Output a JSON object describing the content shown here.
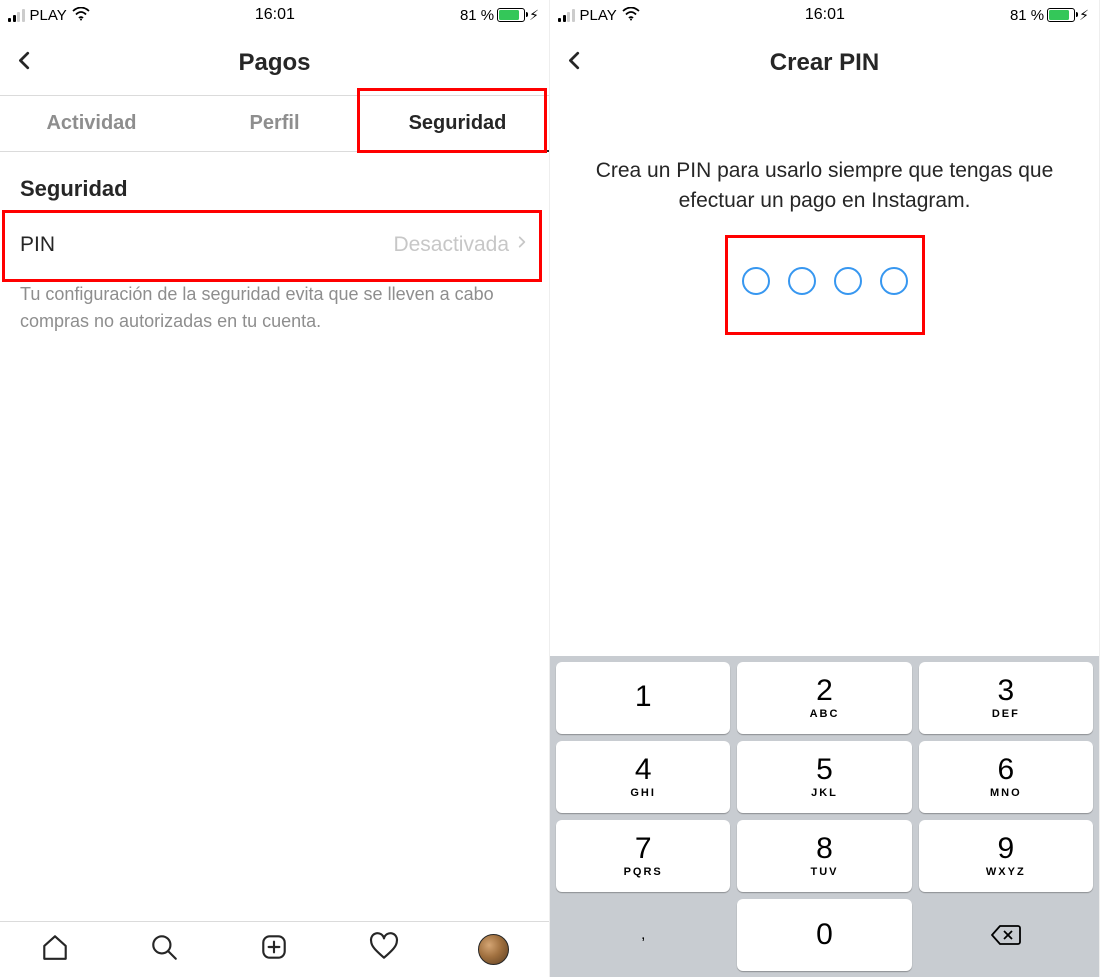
{
  "status": {
    "carrier": "PLAY",
    "time": "16:01",
    "battery_pct": "81 %",
    "battery_fill_pct": 81
  },
  "screen1": {
    "nav_title": "Pagos",
    "tabs": {
      "activity": "Actividad",
      "profile": "Perfil",
      "security": "Seguridad"
    },
    "section_title": "Seguridad",
    "pin_row": {
      "label": "PIN",
      "value": "Desactivada"
    },
    "help_text": "Tu configuración de la seguridad evita que se lleven a cabo compras no autorizadas en tu cuenta."
  },
  "screen2": {
    "nav_title": "Crear PIN",
    "instruction": "Crea un PIN para usarlo siempre que tengas que efectuar un pago en Instagram."
  },
  "keypad": {
    "k1": {
      "n": "1",
      "l": ""
    },
    "k2": {
      "n": "2",
      "l": "ABC"
    },
    "k3": {
      "n": "3",
      "l": "DEF"
    },
    "k4": {
      "n": "4",
      "l": "GHI"
    },
    "k5": {
      "n": "5",
      "l": "JKL"
    },
    "k6": {
      "n": "6",
      "l": "MNO"
    },
    "k7": {
      "n": "7",
      "l": "PQRS"
    },
    "k8": {
      "n": "8",
      "l": "TUV"
    },
    "k9": {
      "n": "9",
      "l": "WXYZ"
    },
    "k0": {
      "n": "0",
      "l": ""
    },
    "comma": ","
  }
}
